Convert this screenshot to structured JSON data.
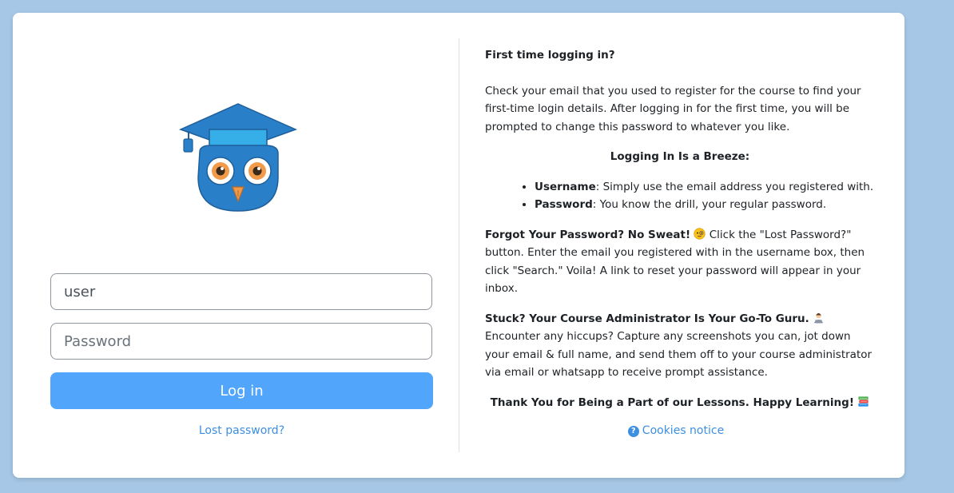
{
  "login": {
    "username_value": "user",
    "password_placeholder": "Password",
    "login_button": "Log in",
    "lost_password_link": "Lost password?"
  },
  "info": {
    "first_time_title": "First time logging in?",
    "first_time_text": "Check your email that you used to register for the course to find your first-time login details. After logging in for the first time, you will be prompted to change this password to whatever you like.",
    "breeze_title": "Logging In Is a Breeze:",
    "bullets": [
      {
        "label": "Username",
        "text": ": Simply use the email address you registered with."
      },
      {
        "label": "Password",
        "text": ": You know the drill, your regular password."
      }
    ],
    "forgot_title": "Forgot Your Password? No Sweat!",
    "forgot_text": " Click the \"Lost Password?\" button. Enter the email you registered with in the username box, then click \"Search.\" Voila! A link to reset your password will appear in your inbox.",
    "stuck_title": "Stuck? Your Course Administrator Is Your Go-To Guru.",
    "stuck_text": " Encounter any hiccups? Capture any screenshots you can, jot down your email & full name, and send them off to your course administrator via email or whatsapp to receive prompt assistance.",
    "thanks": "Thank You for Being a Part of our Lessons. Happy Learning!",
    "cookies_link": "Cookies notice"
  },
  "icons": {
    "logo": "owl-graduate-logo",
    "forgot_emoji": "monocle-face-icon",
    "stuck_emoji": "technologist-icon",
    "thanks_emoji": "books-icon",
    "cookies_icon": "question-circle-icon"
  },
  "colors": {
    "background": "#a6c8e6",
    "primary_button": "#51a5fb",
    "link": "#3d8fe0",
    "owl_blue": "#2a7fc9"
  }
}
